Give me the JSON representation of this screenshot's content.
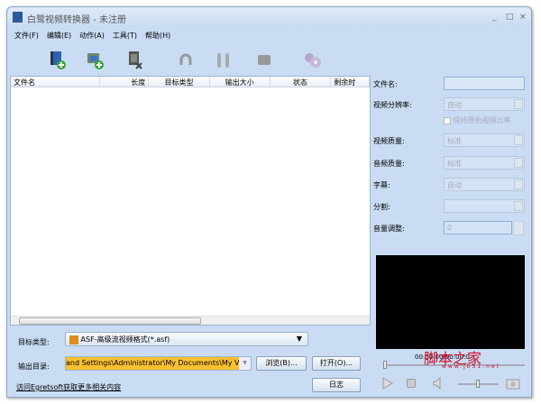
{
  "window": {
    "title": "白鹭视频转换器 - 未注册",
    "minimize": "_",
    "maximize": "□",
    "close": "×"
  },
  "menu": [
    "文件(F)",
    "编辑(E)",
    "动作(A)",
    "工具(T)",
    "帮助(H)"
  ],
  "list": {
    "columns": [
      "文件名",
      "长度",
      "目标类型",
      "输出大小",
      "状态",
      "剩余时"
    ]
  },
  "props": {
    "filename_label": "文件名:",
    "resolution_label": "视频分辨率:",
    "resolution_value": "自动",
    "keep_ratio": "保持原始视频比率",
    "vquality_label": "视频质量:",
    "vquality_value": "标准",
    "aquality_label": "音频质量:",
    "aquality_value": "标准",
    "subtitle_label": "字幕:",
    "subtitle_value": "自动",
    "split_label": "分割:",
    "split_value": "",
    "volume_label": "音量调整:",
    "volume_value": "0"
  },
  "bottom": {
    "target_label": "目标类型:",
    "target_value": "ASF-高级流视频格式(*.asf)",
    "output_label": "输出目录:",
    "output_value": "and Settings\\Administrator\\My Documents\\My Videos",
    "browse": "浏览(B)...",
    "open": "打开(O)...",
    "log": "日志",
    "link": "访问Egretsoft获取更多相关内容"
  },
  "player": {
    "time": "00:00:00/00:00:0"
  },
  "watermark": {
    "text": "脚本之家",
    "url": "www.jb51.net"
  }
}
